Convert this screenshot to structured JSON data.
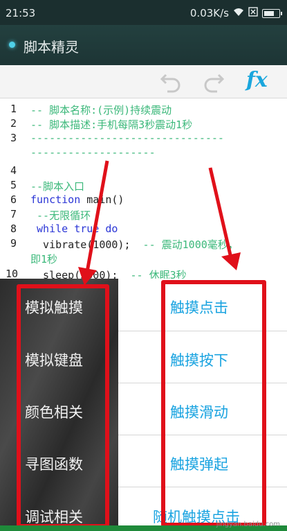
{
  "status": {
    "time": "21:53",
    "speed": "0.03K/s"
  },
  "title": "脚本精灵",
  "toolbar": {
    "undo_icon": "undo-icon",
    "redo_icon": "redo-icon",
    "fx_label": "fx"
  },
  "code": {
    "line_numbers": [
      "1",
      "2",
      "3",
      "4",
      "5",
      "6",
      "7",
      "8",
      "9",
      "10"
    ],
    "l1": "-- 脚本名称:(示例)持续震动",
    "l2": "-- 脚本描述:手机每隔3秒震动1秒",
    "l3a": "-------------------------------",
    "l3b": "--------------------",
    "l5": "--脚本入口",
    "l6_kw": "function",
    "l6_rest": " main()",
    "l7": " --无限循环",
    "l8_kw1": " while",
    "l8_kw2": " true",
    "l8_kw3": " do",
    "l9_code": "  vibrate(1000);",
    "l9_comment": "  -- 震动1000毫秒，",
    "l9_cont": "即1秒",
    "l10_code": "  sleep(3000);",
    "l10_comment": "  -- 休眠3秒"
  },
  "left_menu": [
    "模拟触摸",
    "模拟键盘",
    "颜色相关",
    "寻图函数",
    "调试相关"
  ],
  "right_menu": [
    "触摸点击",
    "触摸按下",
    "触摸滑动",
    "触摸弹起",
    "随机触摸点击"
  ],
  "watermark": "jingyan.baidu.com",
  "colors": {
    "annotation": "#e0101a",
    "link": "#19a3e0",
    "comment": "#3bb87a",
    "keyword": "#2b36d6"
  }
}
